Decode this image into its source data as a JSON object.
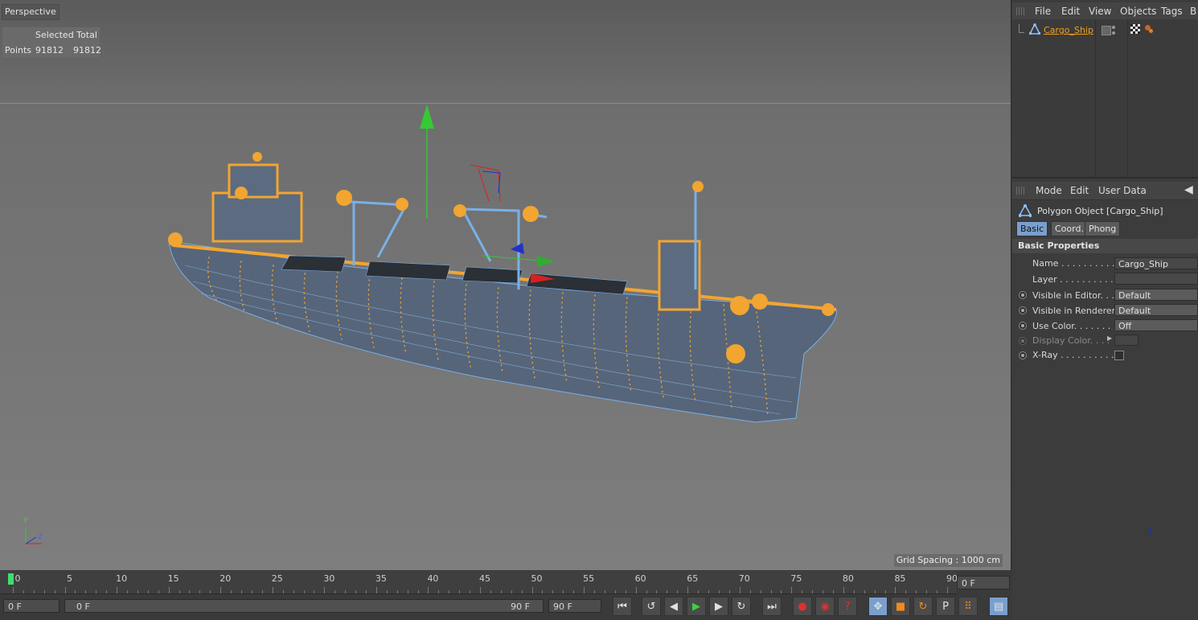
{
  "viewport": {
    "label": "Perspective",
    "stats": {
      "header": "Selected Total",
      "row_label": "Points",
      "selected": "91812",
      "total": "91812"
    },
    "grid_spacing": "Grid Spacing : 1000 cm",
    "axis_y": "Y",
    "axis_z": "Z"
  },
  "objects_panel": {
    "menu": [
      "File",
      "Edit",
      "View",
      "Objects",
      "Tags",
      "B"
    ],
    "object_name": "Cargo_Ship"
  },
  "attributes_panel": {
    "menu": [
      "Mode",
      "Edit",
      "User Data"
    ],
    "title": "Polygon Object [Cargo_Ship]",
    "tabs": [
      "Basic",
      "Coord.",
      "Phong"
    ],
    "section": "Basic Properties",
    "props": {
      "name_label": "Name . . . . . . . . . . .",
      "name_value": "Cargo_Ship",
      "layer_label": "Layer . . . . . . . . . . . .",
      "visible_editor_label": "Visible in Editor. . .",
      "visible_editor_value": "Default",
      "visible_renderer_label": "Visible in Renderer",
      "visible_renderer_value": "Default",
      "use_color_label": "Use Color. . . . . . . .",
      "use_color_value": "Off",
      "display_color_label": "Display Color. . . .",
      "xray_label": "X-Ray . . . . . . . . . . ."
    }
  },
  "timeline": {
    "ticks": [
      "0",
      "5",
      "10",
      "15",
      "20",
      "25",
      "30",
      "35",
      "40",
      "45",
      "50",
      "55",
      "60",
      "65",
      "70",
      "75",
      "80",
      "85",
      "90"
    ],
    "current_frame_right": "0 F",
    "start_frame": "0 F",
    "range_start": "0 F",
    "range_end": "90 F",
    "end_frame": "90 F"
  }
}
